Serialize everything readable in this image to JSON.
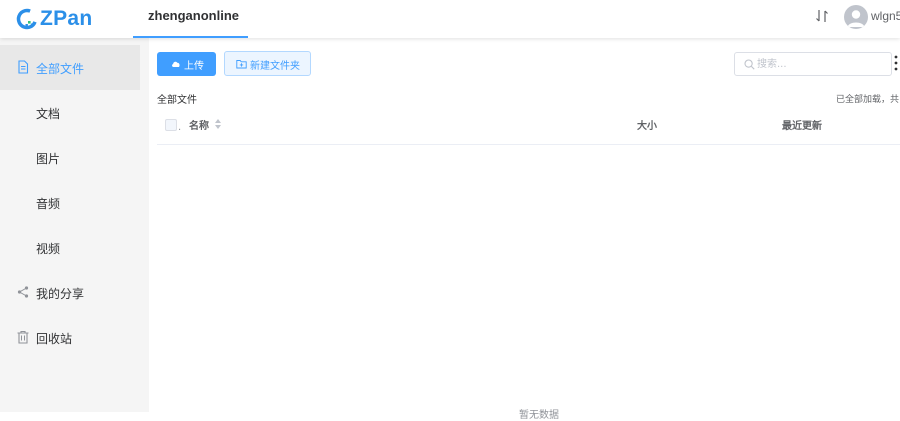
{
  "header": {
    "logo_text": "ZPan",
    "active_tab": "zhenganonline",
    "username": "wlgn5"
  },
  "sidebar": {
    "items": [
      {
        "label": "全部文件",
        "icon": "document-icon",
        "active": true
      },
      {
        "label": "文档",
        "icon": ""
      },
      {
        "label": "图片",
        "icon": ""
      },
      {
        "label": "音频",
        "icon": ""
      },
      {
        "label": "视频",
        "icon": ""
      },
      {
        "label": "我的分享",
        "icon": "share-icon"
      },
      {
        "label": "回收站",
        "icon": "trash-icon"
      }
    ]
  },
  "toolbar": {
    "upload_label": "上传",
    "new_folder_label": "新建文件夹",
    "search_placeholder": "搜索..."
  },
  "breadcrumb": "全部文件",
  "status_text": "已全部加载，共",
  "table": {
    "columns": [
      "名称",
      "大小",
      "最近更新"
    ],
    "rows": [],
    "empty_text": "暂无数据"
  },
  "colors": {
    "accent": "#409eff",
    "logo": "#2b8fe8",
    "sidebar_bg": "#f5f5f5"
  }
}
